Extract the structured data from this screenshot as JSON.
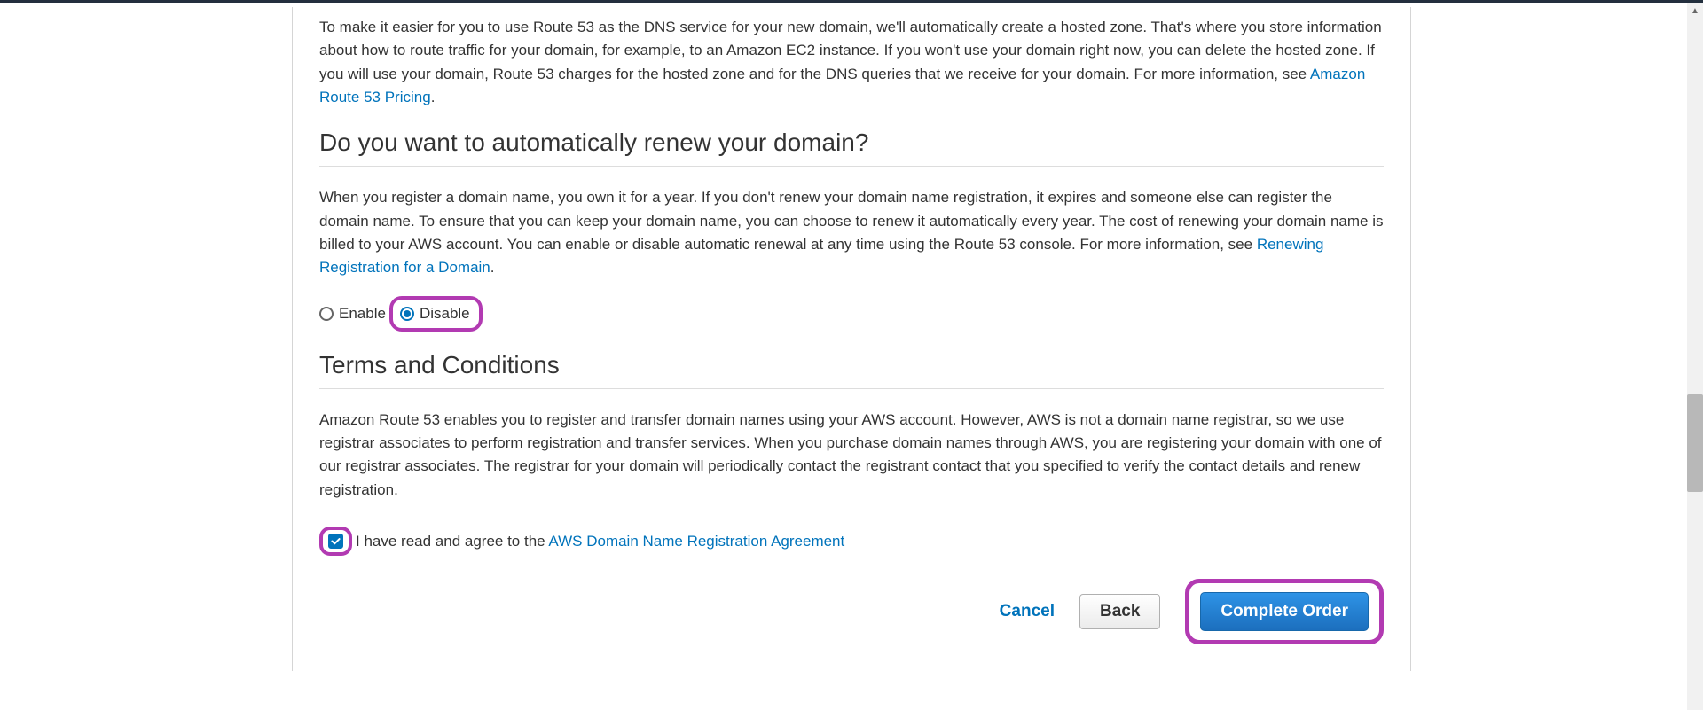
{
  "hosted_zone": {
    "text_before_link": "To make it easier for you to use Route 53 as the DNS service for your new domain, we'll automatically create a hosted zone. That's where you store information about how to route traffic for your domain, for example, to an Amazon EC2 instance. If you won't use your domain right now, you can delete the hosted zone. If you will use your domain, Route 53 charges for the hosted zone and for the DNS queries that we receive for your domain. For more information, see ",
    "link_text": "Amazon Route 53 Pricing",
    "text_after_link": "."
  },
  "auto_renew": {
    "heading": "Do you want to automatically renew your domain?",
    "text_before_link": "When you register a domain name, you own it for a year. If you don't renew your domain name registration, it expires and someone else can register the domain name. To ensure that you can keep your domain name, you can choose to renew it automatically every year. The cost of renewing your domain name is billed to your AWS account. You can enable or disable automatic renewal at any time using the Route 53 console. For more information, see ",
    "link_text": "Renewing Registration for a Domain",
    "text_after_link": ".",
    "enable_label": "Enable",
    "disable_label": "Disable"
  },
  "terms": {
    "heading": "Terms and Conditions",
    "body": "Amazon Route 53 enables you to register and transfer domain names using your AWS account. However, AWS is not a domain name registrar, so we use registrar associates to perform registration and transfer services. When you purchase domain names through AWS, you are registering your domain with one of our registrar associates. The registrar for your domain will periodically contact the registrant contact that you specified to verify the contact details and renew registration.",
    "agree_prefix": "I have read and agree to the ",
    "agree_link": "AWS Domain Name Registration Agreement"
  },
  "buttons": {
    "cancel": "Cancel",
    "back": "Back",
    "complete": "Complete Order"
  }
}
